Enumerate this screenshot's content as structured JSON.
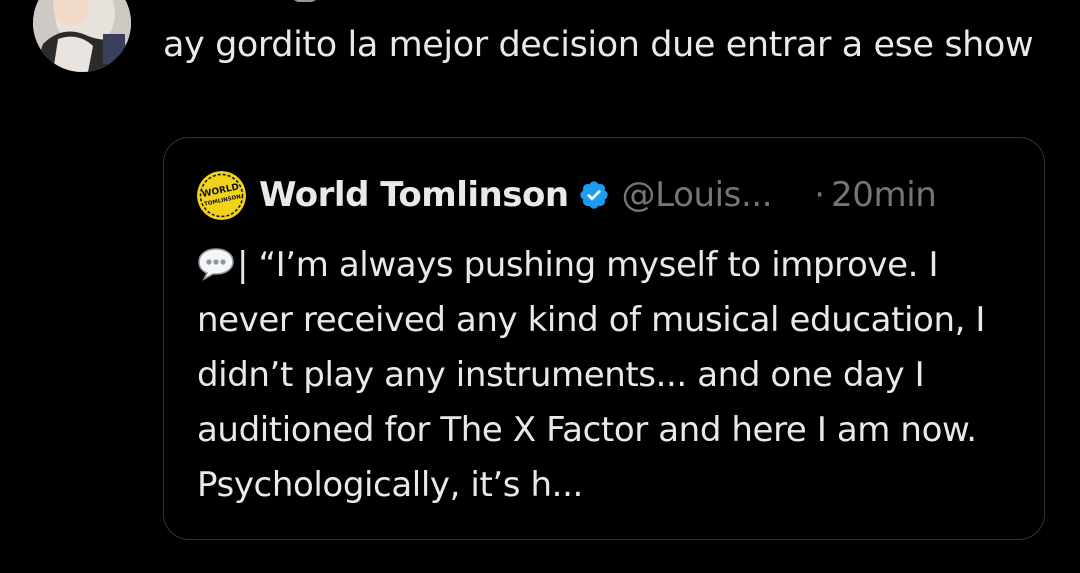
{
  "reply": {
    "text": "ay gordito la mejor decision due entrar a ese show"
  },
  "quote": {
    "author_name": "World Tomlinson",
    "author_avatar_text": "WORLD TOMLINSON",
    "handle": "@Louis...",
    "separator": "·",
    "time": "20min",
    "body": "| “I’m always pushing myself to improve. I never received any kind of musical education, I didn’t play any instruments... and one day I auditioned for The X Factor and here I am now. Psychologically, it’s h..."
  },
  "icons": {
    "verified": "verified-badge-icon",
    "speech": "speech-balloon-icon"
  },
  "colors": {
    "background": "#000000",
    "text_primary": "#e7e9ea",
    "text_secondary": "#71767b",
    "border": "#2f3336",
    "verified": "#1d9bf0"
  }
}
